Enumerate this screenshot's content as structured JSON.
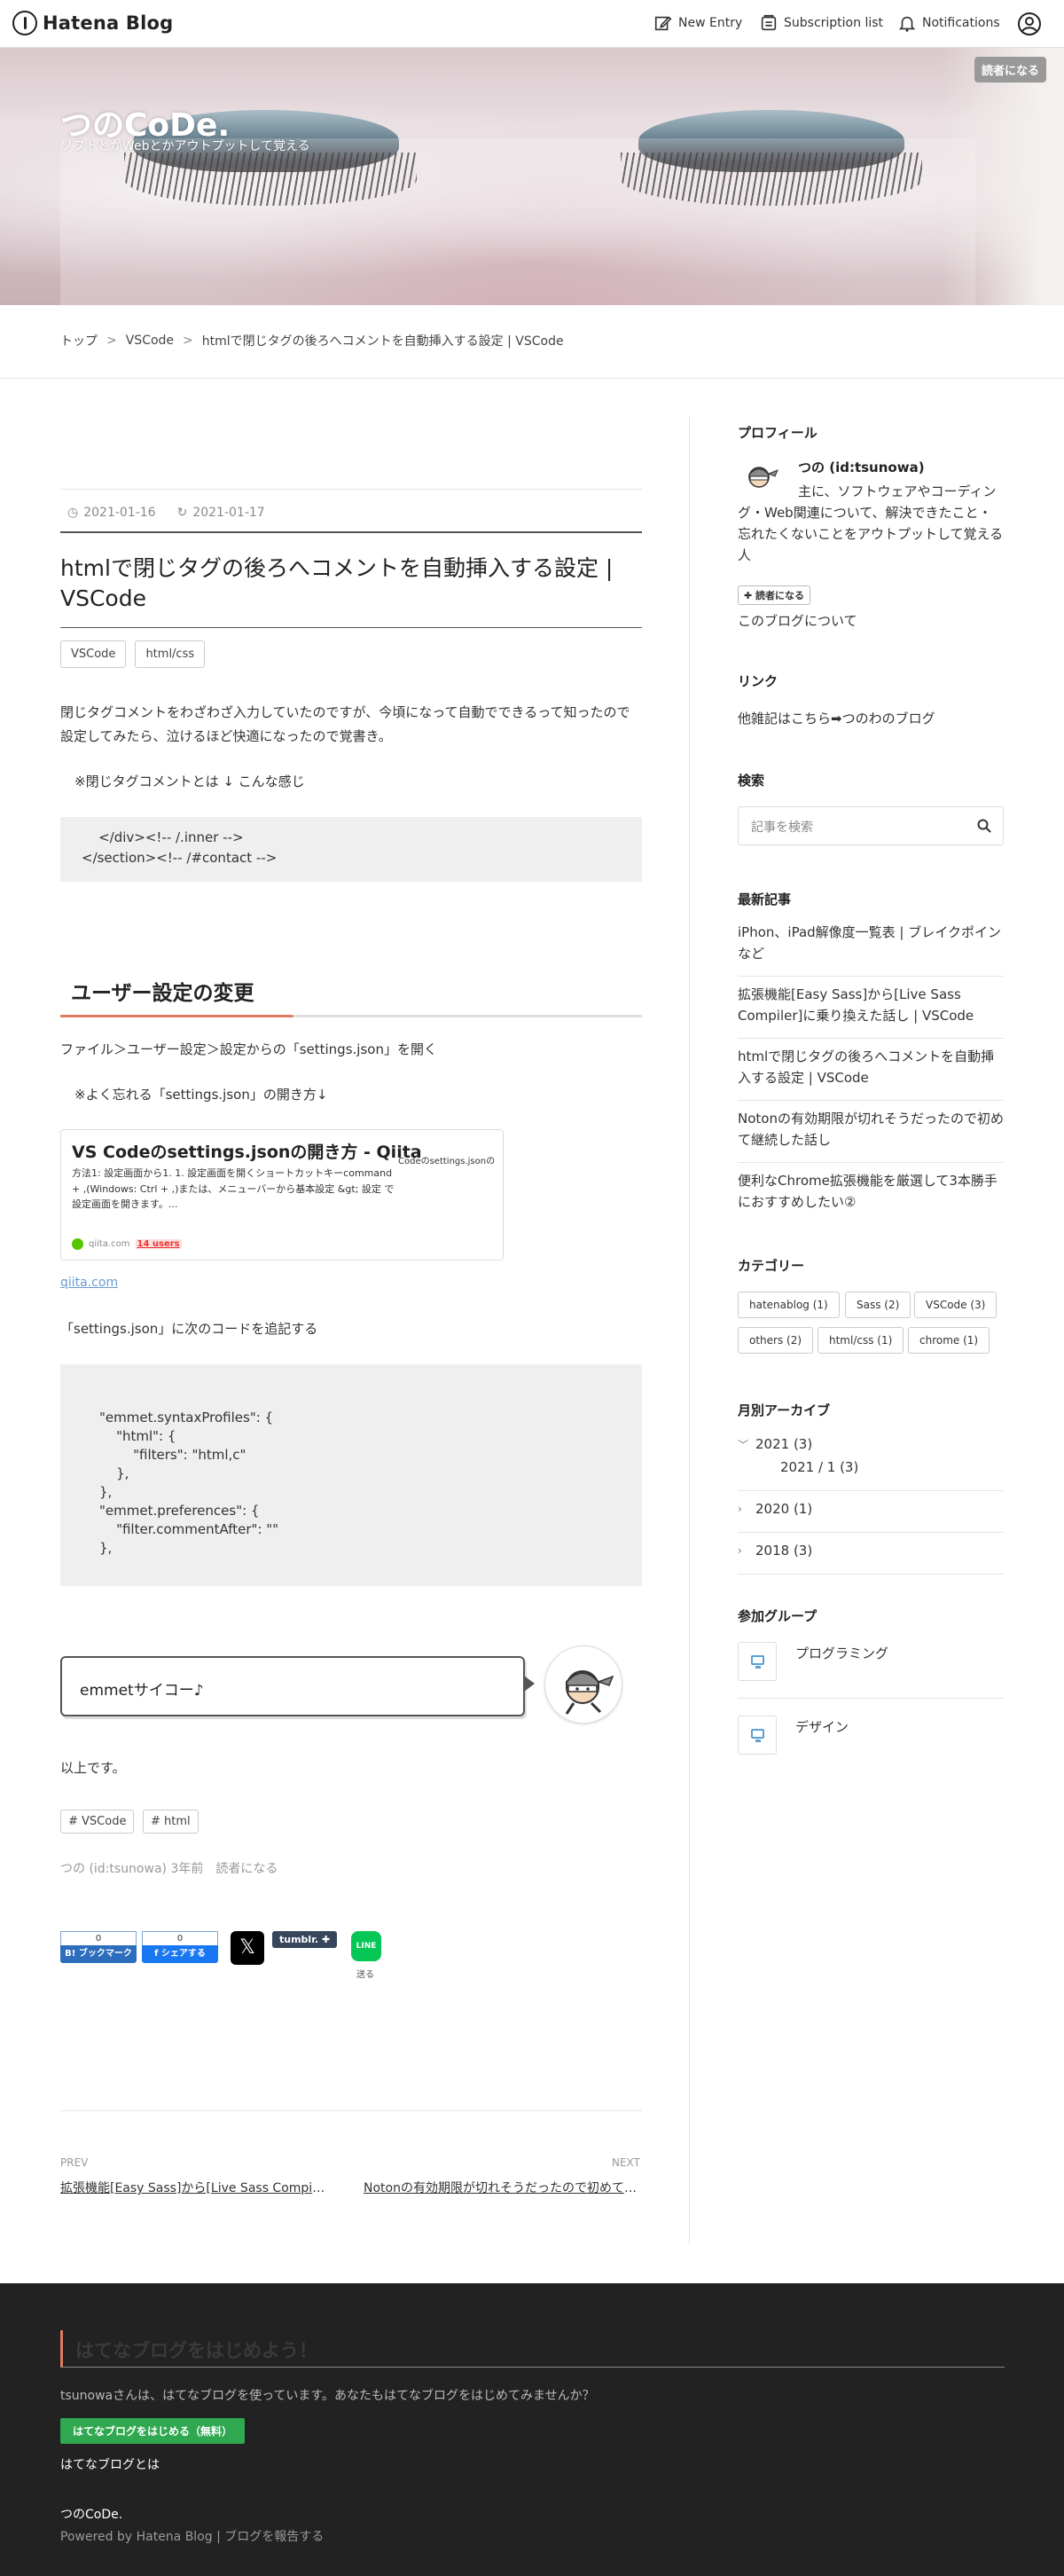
{
  "topbar": {
    "brand": "Hatena Blog",
    "new_entry": "New Entry",
    "subscription_list": "Subscription list",
    "notifications": "Notifications"
  },
  "header": {
    "blog_title": "つのCoDe.",
    "blog_description": "ソフトとかWebとかアウトプットして覚える",
    "subscribe_button": "読者になる"
  },
  "breadcrumb": {
    "items": [
      "トップ",
      "VSCode",
      "htmlで閉じタグの後ろへコメントを自動挿入する設定 | VSCode"
    ],
    "sep": ">"
  },
  "article": {
    "date_published": "2021-01-16",
    "date_updated": "2021-01-17",
    "title": "htmlで閉じタグの後ろへコメントを自動挿入する設定 | VSCode",
    "categories": [
      "VSCode",
      "html/css"
    ],
    "intro": "閉じタグコメントをわざわざ入力していたのですが、今頃になって自動でできるって知ったので設定してみたら、泣けるほど快適になったので覚書き。",
    "note1": "※閉じタグコメントとは ↓ こんな感じ",
    "code1": "    </div><!-- /.inner -->\n</section><!-- /#contact -->",
    "h2": "ユーザー設定の変更",
    "step1": "ファイル＞ユーザー設定＞設定からの「settings.json」を開く",
    "note2": "※よく忘れる「settings.json」の開き方↓",
    "card": {
      "title": "VS Codeのsettings.jsonの開き方 - Qiita",
      "desc": "方法1: 設定画面から1. 1. 設定画面を開くショートカットキーcommand + ,(Windows: Ctrl + ,)または、メニューバーから基本設定 &gt; 設定 で設定画面を開きます。...",
      "thumb_text": "Codeのsettings.jsonの",
      "site": "qiita.com",
      "users": "14 users"
    },
    "qiita_link": "qiita.com",
    "step2": "「settings.json」に次のコードを追記する",
    "code2": "\"emmet.syntaxProfiles\": {\n    \"html\": {\n        \"filters\": \"html,c\"\n    },\n},\n\"emmet.preferences\": {\n    \"filter.commentAfter\": \"\"\n},",
    "balloon": "emmetサイコー♪",
    "outro": "以上です。",
    "tags": [
      "# VSCode",
      "# html"
    ],
    "byline": "つの (id:tsunowa) 3年前　読者になる"
  },
  "share": {
    "hatena_count": "0",
    "hatena_label": "B! ブックマーク",
    "fb_count": "0",
    "fb_label": "f シェアする",
    "x_label": "𝕏",
    "tumblr_label": "tumblr. ✚",
    "line_label": "LINE",
    "line_sub": "送る"
  },
  "pager": {
    "prev_label": "PREV",
    "prev_title": "拡張機能[Easy Sass]から[Live Sass Compiler]に乗り換えた話し",
    "next_label": "NEXT",
    "next_title": "Notonの有効期限が切れそうだったので初めて継続した話し"
  },
  "sidebar": {
    "profile_heading": "プロフィール",
    "profile_name": "つの (id:tsunowa)",
    "profile_text": "主に、ソフトウェアやコーディング・Web関連について、解決できたこと・忘れたくないことをアウトプットして覚える人",
    "profile_button": "✚ 読者になる",
    "about_link": "このブログについて",
    "links_heading": "リンク",
    "links_item": "他雑記はこちら➡つのわのブログ",
    "search_heading": "検索",
    "search_placeholder": "記事を検索",
    "recent_heading": "最新記事",
    "recent": [
      "iPhon、iPad解像度一覧表 | ブレイクポインなど",
      "拡張機能[Easy Sass]から[Live Sass Compiler]に乗り換えた話し | VSCode",
      "htmlで閉じタグの後ろへコメントを自動挿入する設定 | VSCode",
      "Notonの有効期限が切れそうだったので初めて継続した話し",
      "便利なChrome拡張機能を厳選して3本勝手におすすめしたい②"
    ],
    "category_heading": "カテゴリー",
    "categories": [
      "hatenablog (1)",
      "Sass (2)",
      "VSCode (3)",
      "others (2)",
      "html/css (1)",
      "chrome (1)"
    ],
    "archive_heading": "月別アーカイブ",
    "archive": [
      "2021 (3)",
      "2021 / 1 (3)",
      "2020 (1)",
      "2018 (3)"
    ],
    "groups_heading": "参加グループ",
    "groups": [
      "プログラミング",
      "デザイン"
    ]
  },
  "footer": {
    "title": "はてなブログをはじめよう！",
    "text": "tsunowaさんは、はてなブログを使っています。あなたもはてなブログをはじめてみませんか？",
    "button": "はてなブログをはじめる（無料）",
    "link": "はてなブログとは",
    "blog_name": "つのCoDe.",
    "powered": "Powered by Hatena Blog | ブログを報告する"
  }
}
